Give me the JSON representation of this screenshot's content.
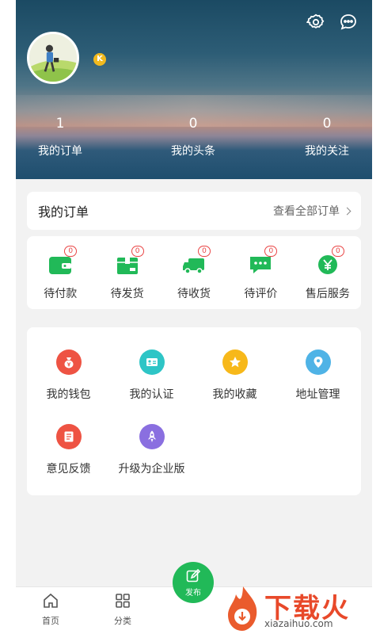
{
  "header": {
    "stats": [
      {
        "count": "1",
        "label": "我的订单"
      },
      {
        "count": "0",
        "label": "我的头条"
      },
      {
        "count": "0",
        "label": "我的关注"
      }
    ],
    "level_badge": "K",
    "icons": [
      "gear-icon",
      "chat-bubble-icon"
    ]
  },
  "orders": {
    "title": "我的订单",
    "view_all": "查看全部订单",
    "status": [
      {
        "label": "待付款",
        "badge": "0",
        "icon": "wallet-icon"
      },
      {
        "label": "待发货",
        "badge": "0",
        "icon": "package-icon"
      },
      {
        "label": "待收货",
        "badge": "0",
        "icon": "truck-icon"
      },
      {
        "label": "待评价",
        "badge": "0",
        "icon": "comment-icon"
      },
      {
        "label": "售后服务",
        "badge": "0",
        "icon": "yen-coin-icon"
      }
    ]
  },
  "tools": [
    {
      "label": "我的钱包",
      "icon": "money-bag-icon",
      "color": "#ee5343"
    },
    {
      "label": "我的认证",
      "icon": "id-card-icon",
      "color": "#2ec5c6"
    },
    {
      "label": "我的收藏",
      "icon": "star-icon",
      "color": "#f7b81a"
    },
    {
      "label": "地址管理",
      "icon": "location-pin-icon",
      "color": "#4fb3e6"
    },
    {
      "label": "意见反馈",
      "icon": "feedback-list-icon",
      "color": "#ee5343"
    },
    {
      "label": "升级为企业版",
      "icon": "rocket-icon",
      "color": "#8a6fe0"
    }
  ],
  "tabbar": {
    "home": "首页",
    "category": "分类",
    "publish": "发布"
  },
  "watermark": {
    "brand": "下载火",
    "url": "xiazaihuo.com"
  },
  "colors": {
    "accent_green": "#21b958",
    "badge_red": "#e94545"
  }
}
